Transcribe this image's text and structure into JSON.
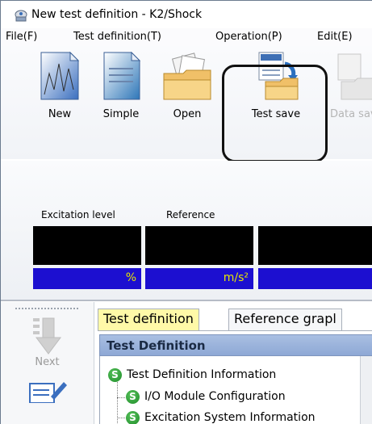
{
  "window": {
    "title": "New test definition - K2/Shock",
    "app_icon": "k2-shock-app-icon"
  },
  "menu": {
    "items": [
      "File(F)",
      "Test definition(T)",
      "Operation(P)",
      "Edit(E)"
    ]
  },
  "toolbar": {
    "buttons": [
      {
        "label": "New",
        "icon": "new-document-icon",
        "enabled": true
      },
      {
        "label": "Simple",
        "icon": "simple-document-icon",
        "enabled": true
      },
      {
        "label": "Open",
        "icon": "open-folder-icon",
        "enabled": true
      },
      {
        "label": "Test save",
        "icon": "test-save-icon",
        "enabled": true,
        "highlighted": true
      },
      {
        "label": "Data sav",
        "icon": "data-save-icon",
        "enabled": false
      }
    ]
  },
  "monitor": {
    "labels": [
      "Excitation level",
      "Reference"
    ],
    "meters": [
      {
        "unit": "%"
      },
      {
        "unit": "m/s²"
      },
      {
        "unit": ""
      }
    ]
  },
  "side_panel": {
    "next_label": "Next",
    "next_icon": "down-arrow-icon",
    "edit_icon": "edit-pencil-icon"
  },
  "tabs": [
    "Test definition",
    "Reference grapl"
  ],
  "test_definition": {
    "header": "Test Definition",
    "tree": [
      {
        "label": "Test Definition Information",
        "level": 0
      },
      {
        "label": "I/O Module Configuration",
        "level": 1
      },
      {
        "label": "Excitation System Information",
        "level": 1
      }
    ]
  },
  "colors": {
    "meter_unit_bar": "#1c0fd0",
    "meter_unit_text": "#e6e600",
    "active_tab": "#fff9a8",
    "header_blue": "#9bb4dc",
    "status_green": "#2e9e37"
  }
}
